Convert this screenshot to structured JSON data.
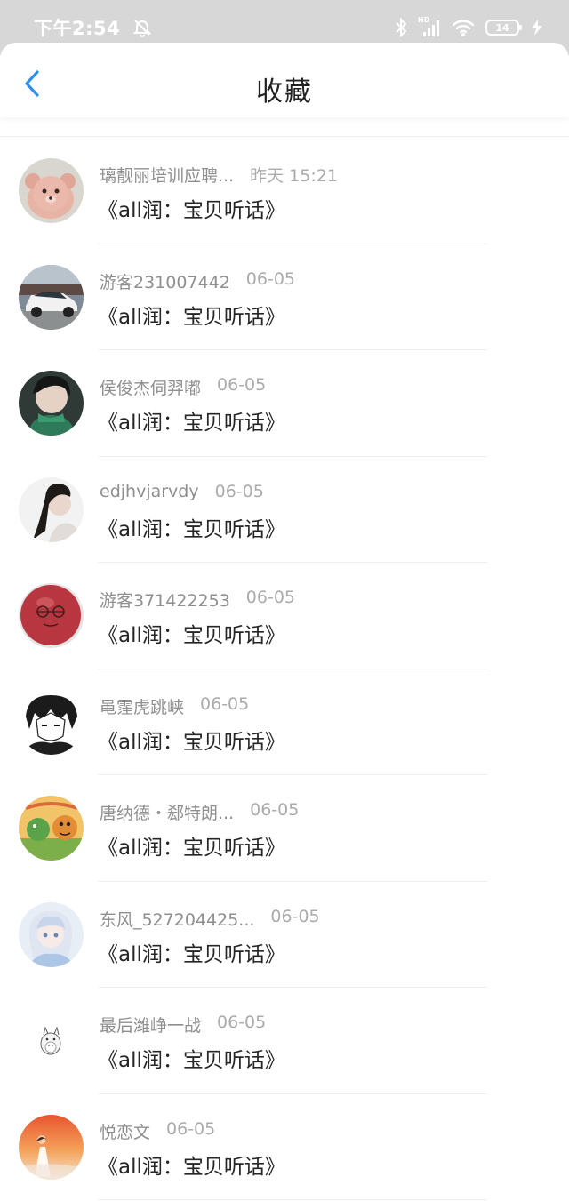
{
  "status_bar": {
    "time": "下午2:54",
    "battery": "14",
    "network_badge": "HD"
  },
  "header": {
    "title": "收藏"
  },
  "items": [
    {
      "name": "璃靓丽培训应聘...",
      "time": "昨天 15:21",
      "content": "《all润：宝贝听话》",
      "avatar": "plush-bear"
    },
    {
      "name": "游客231007442",
      "time": "06-05",
      "content": "《all润：宝贝听话》",
      "avatar": "white-car"
    },
    {
      "name": "侯俊杰伺羿嘟",
      "time": "06-05",
      "content": "《all润：宝贝听话》",
      "avatar": "person-green-scarf"
    },
    {
      "name": "edjhvjarvdy",
      "time": "06-05",
      "content": "《all润：宝贝听话》",
      "avatar": "woman-portrait"
    },
    {
      "name": "游客371422253",
      "time": "06-05",
      "content": "《all润：宝贝听话》",
      "avatar": "red-ball-face"
    },
    {
      "name": "黾霔虎跳峡",
      "time": "06-05",
      "content": "《all润：宝贝听话》",
      "avatar": "anime-boy-bw"
    },
    {
      "name": "唐纳德・郄特朗...",
      "time": "06-05",
      "content": "《all润：宝贝听话》",
      "avatar": "cartoon-scene"
    },
    {
      "name": "东风_527204425...",
      "time": "06-05",
      "content": "《all润：宝贝听话》",
      "avatar": "anime-girl-pastel"
    },
    {
      "name": "最后潍峥一战",
      "time": "06-05",
      "content": "《all润：宝贝听话》",
      "avatar": "totoro-sketch"
    },
    {
      "name": "悦恋文",
      "time": "06-05",
      "content": "《all润：宝贝听话》",
      "avatar": "sunset-figure"
    }
  ],
  "colors": {
    "accent": "#2f8fe8",
    "status_bar_bg": "#d7d7d7",
    "title_text": "#222222",
    "meta_text": "#8f8f8f"
  }
}
